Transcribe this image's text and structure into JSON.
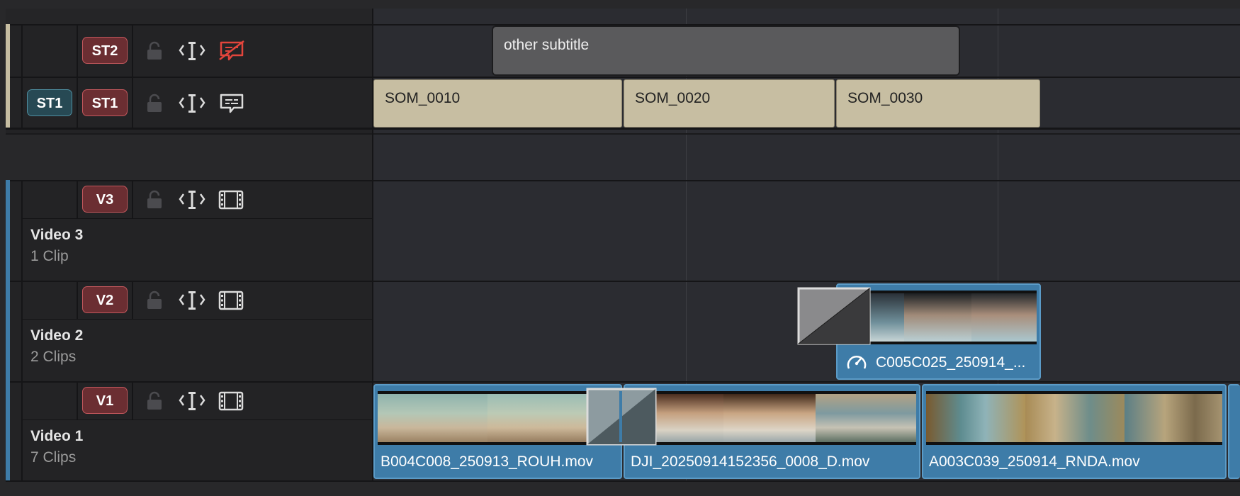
{
  "subtitle_tracks": [
    {
      "id": "ST2",
      "lock_icon": "lock-icon",
      "auto_select_icon": "auto-select-icon",
      "toggle_icon": "subtitle-disabled-icon"
    },
    {
      "id": "ST1",
      "source_badge": "ST1",
      "lock_icon": "lock-icon",
      "auto_select_icon": "auto-select-icon",
      "toggle_icon": "subtitle-icon"
    }
  ],
  "video_tracks": [
    {
      "id": "V3",
      "name": "Video 3",
      "count": "1 Clip"
    },
    {
      "id": "V2",
      "name": "Video 2",
      "count": "2 Clips"
    },
    {
      "id": "V1",
      "name": "Video 1",
      "count": "7 Clips"
    }
  ],
  "subtitle_clips": {
    "st2": [
      "other subtitle"
    ],
    "st1": [
      "SOM_0010",
      "SOM_0020",
      "SOM_0030"
    ]
  },
  "video_clips": {
    "v2": [
      {
        "label": "C005C025_250914_...",
        "icon": "speed-change-icon"
      }
    ],
    "v1": [
      {
        "label": "B004C008_250913_ROUH.mov"
      },
      {
        "label": "DJI_20250914152356_0008_D.mov"
      },
      {
        "label": "A003C039_250914_RNDA.mov"
      }
    ]
  },
  "colors": {
    "subtitle_clip": "#c7bea2",
    "video_clip": "#3e7ca8",
    "track_badge": "#6b2e32",
    "source_badge": "#274954",
    "disabled_icon": "#e2453c"
  }
}
